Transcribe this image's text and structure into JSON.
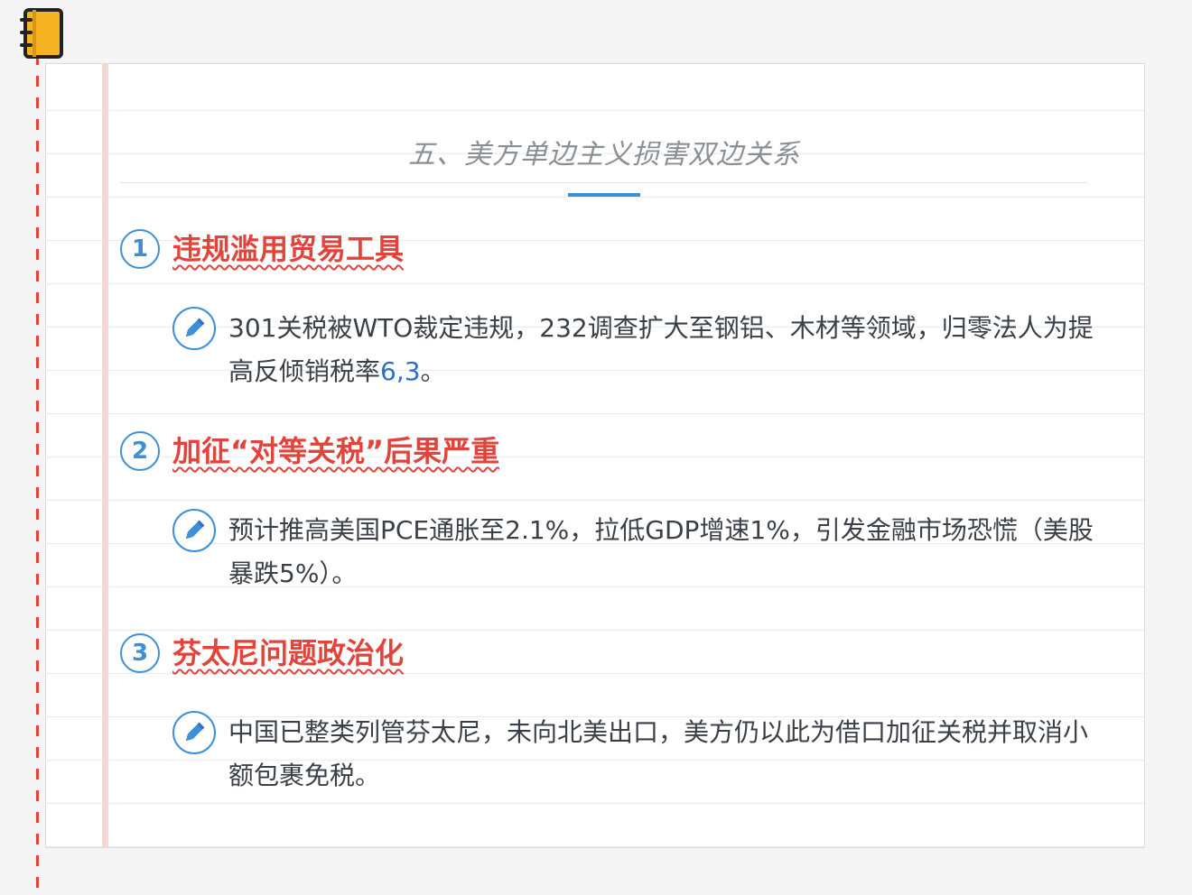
{
  "title": "五、美方单边主义损害双边关系",
  "sections": [
    {
      "number": "1",
      "heading": "违规滥用贸易工具",
      "text": "301关税被WTO裁定违规，232调查扩大至钢铝、木材等领域，归零法人为提高反倾销税率",
      "refs": "6,3",
      "tail": "。"
    },
    {
      "number": "2",
      "heading": "加征“对等关税”后果严重",
      "text": "预计推高美国PCE通胀至2.1%，拉低GDP增速1%，引发金融市场恐慌（美股暴跌5%）。"
    },
    {
      "number": "3",
      "heading": "芬太尼问题政治化",
      "text": "中国已整类列管芬太尼，未向北美出口，美方仍以此为借口加征关税并取消小额包裹免税。"
    }
  ],
  "colors": {
    "accent_blue": "#3d8fd6",
    "heading_red": "#e0443a",
    "margin_pink": "#f8d5d5",
    "ref_blue": "#2c6fc9"
  },
  "icons": {
    "corner": "notebook-icon",
    "bullet": "pencil-icon"
  }
}
